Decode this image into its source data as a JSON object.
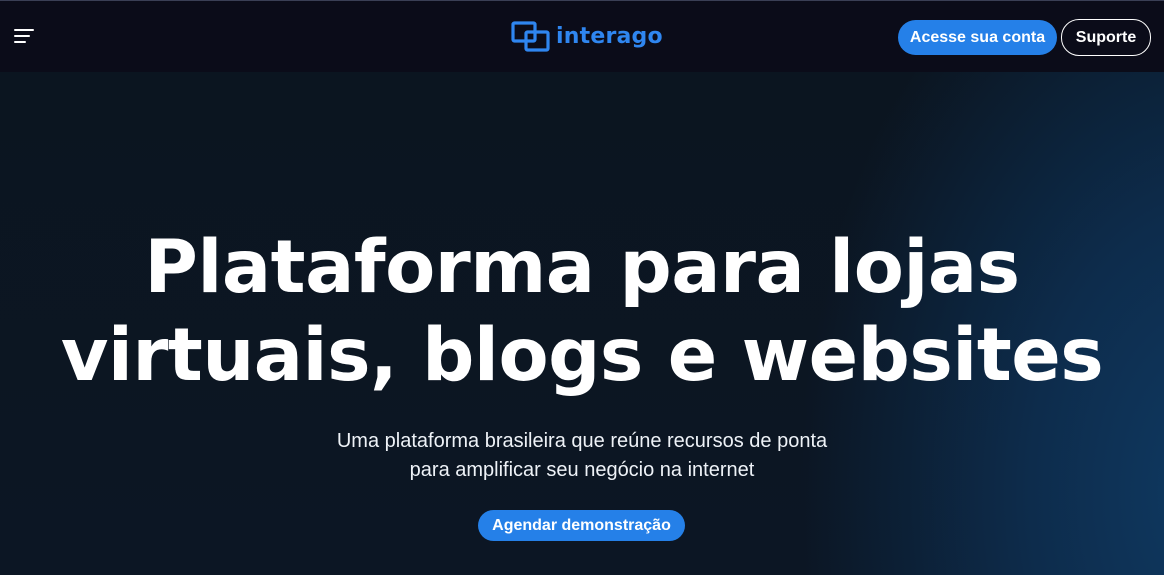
{
  "header": {
    "menu_icon": "hamburger-menu-icon",
    "logo": {
      "icon": "overlapping-squares-logo-icon",
      "text": "interago",
      "color": "#2f86f0"
    },
    "account_button": "Acesse sua conta",
    "support_button": "Suporte"
  },
  "hero": {
    "title_line1": "Plataforma para lojas",
    "title_line2": "virtuais, blogs e websites",
    "subtitle_line1": "Uma plataforma brasileira que reúne recursos de ponta",
    "subtitle_line2": "para amplificar seu negócio na internet",
    "cta_button": "Agendar demonstração"
  },
  "colors": {
    "accent": "#2580e8",
    "header_bg": "#0b0c19",
    "hero_bg": "#0c1522",
    "text": "#ffffff"
  }
}
